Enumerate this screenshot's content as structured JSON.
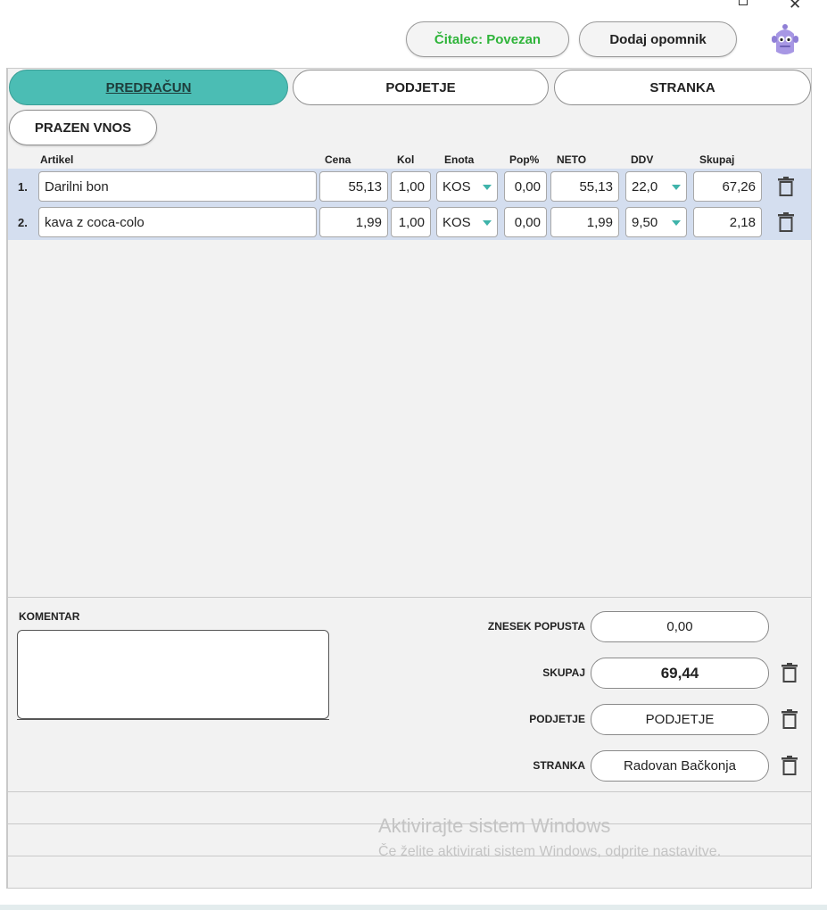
{
  "header": {
    "reader_status": "Čitalec: Povezan",
    "add_reminder": "Dodaj opomnik",
    "reader_color": "#2fb43a"
  },
  "tabs": [
    {
      "label": "PREDRAČUN",
      "active": true
    },
    {
      "label": "PODJETJE",
      "active": false
    },
    {
      "label": "STRANKA",
      "active": false
    }
  ],
  "empty_entry_label": "PRAZEN VNOS",
  "columns": {
    "artikel": "Artikel",
    "cena": "Cena",
    "kol": "Kol",
    "enota": "Enota",
    "pop": "Pop%",
    "neto": "NETO",
    "ddv": "DDV",
    "skupaj": "Skupaj"
  },
  "items": [
    {
      "num": "1.",
      "artikel": "Darilni bon",
      "cena": "55,13",
      "kol": "1,00",
      "enota": "KOS",
      "pop": "0,00",
      "neto": "55,13",
      "ddv": "22,0",
      "skupaj": "67,26"
    },
    {
      "num": "2.",
      "artikel": "kava z coca-colo",
      "cena": "1,99",
      "kol": "1,00",
      "enota": "KOS",
      "pop": "0,00",
      "neto": "1,99",
      "ddv": "9,50",
      "skupaj": "2,18"
    }
  ],
  "comment": {
    "label": "KOMENTAR",
    "value": ""
  },
  "summary": {
    "discount_label": "ZNESEK POPUSTA",
    "discount_value": "0,00",
    "total_label": "SKUPAJ",
    "total_value": "69,44",
    "company_label": "PODJETJE",
    "company_value": "PODJETJE",
    "customer_label": "STRANKA",
    "customer_value": "Radovan Bačkonja"
  },
  "watermark": {
    "title": "Aktivirajte sistem Windows",
    "subtitle": "Če želite aktivirati sistem Windows, odprite nastavitve."
  },
  "colors": {
    "accent": "#4bbdb4",
    "row_bg": "#d4deef",
    "panel_bg": "#f2f2f2"
  }
}
